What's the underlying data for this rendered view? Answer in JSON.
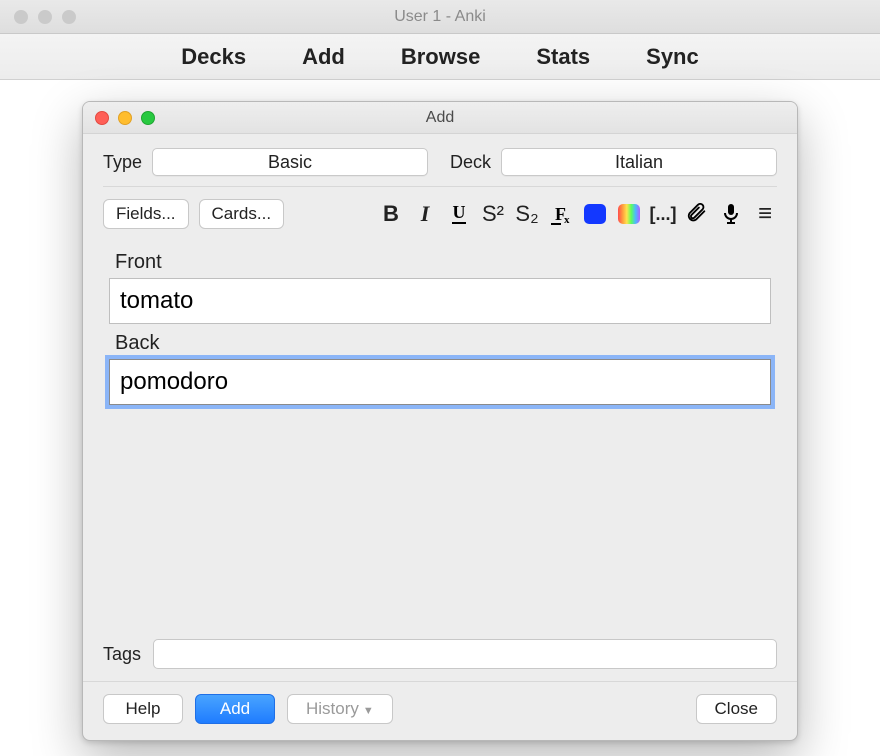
{
  "main_window": {
    "title": "User 1 - Anki",
    "nav": {
      "decks": "Decks",
      "add": "Add",
      "browse": "Browse",
      "stats": "Stats",
      "sync": "Sync"
    }
  },
  "dialog": {
    "title": "Add",
    "type_label": "Type",
    "type_value": "Basic",
    "deck_label": "Deck",
    "deck_value": "Italian",
    "buttons": {
      "fields": "Fields...",
      "cards": "Cards..."
    },
    "toolbar": {
      "bold": "B",
      "italic": "I",
      "underline": "U",
      "superscript": "S²",
      "subscript": "S₂",
      "clear_format": "Fx",
      "color_fg": "blue",
      "color_bg": "rainbow",
      "cloze": "[...]",
      "attach": "attach",
      "record": "mic",
      "more": "≡"
    },
    "fields": {
      "front_label": "Front",
      "front_value": "tomato",
      "back_label": "Back",
      "back_value": "pomodoro"
    },
    "tags": {
      "label": "Tags",
      "value": ""
    },
    "footer": {
      "help": "Help",
      "add": "Add",
      "history": "History",
      "close": "Close"
    }
  }
}
